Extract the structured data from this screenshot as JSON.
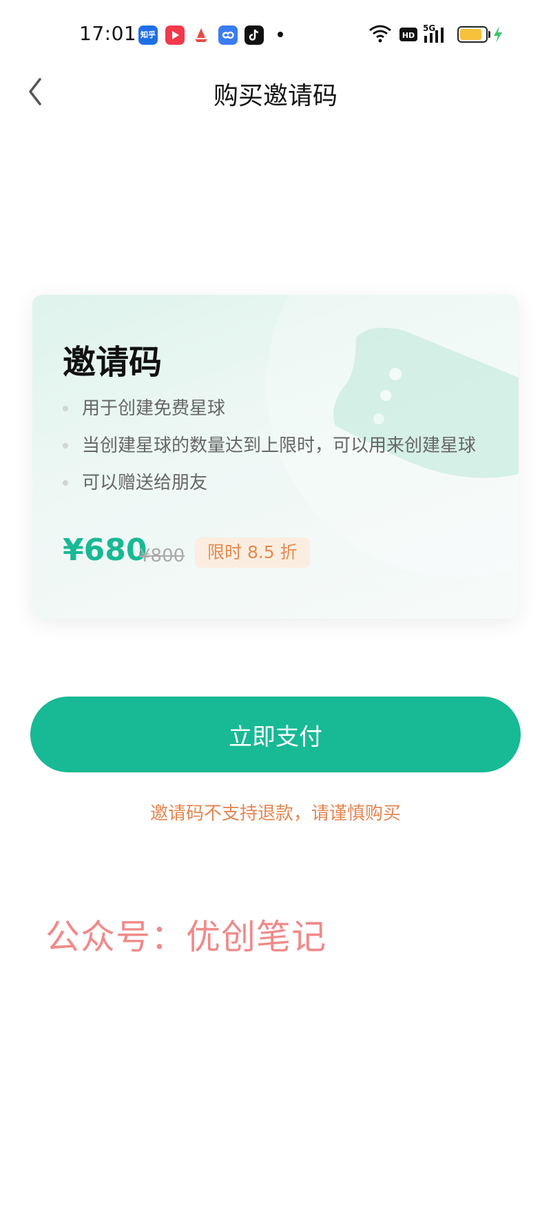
{
  "status_bar": {
    "time": "17:01",
    "apps": [
      {
        "icon": "zhihu-icon",
        "label": "知乎",
        "color": "#1f6fe6"
      },
      {
        "icon": "video-icon",
        "color": "#f2394b"
      },
      {
        "icon": "boat-icon",
        "color": "#e84a45"
      },
      {
        "icon": "cloud-icon",
        "color": "#3a7cf2"
      },
      {
        "icon": "tiktok-icon",
        "color": "#111111"
      }
    ],
    "network": "5G",
    "hd": "HD",
    "battery_level": 0.85
  },
  "nav": {
    "title": "购买邀请码"
  },
  "card": {
    "title": "邀请码",
    "features": [
      "用于创建免费星球",
      "当创建星球的数量达到上限时，可以用来创建星球",
      "可以赠送给朋友"
    ],
    "price": "¥680",
    "original_price": "¥800",
    "discount": "限时 8.5 折"
  },
  "pay_button": "立即支付",
  "notice": "邀请码不支持退款，请谨慎购买",
  "watermark": "公众号：优创笔记",
  "colors": {
    "accent": "#18b995",
    "warning": "#e48652",
    "watermark": "#f08a8a"
  }
}
